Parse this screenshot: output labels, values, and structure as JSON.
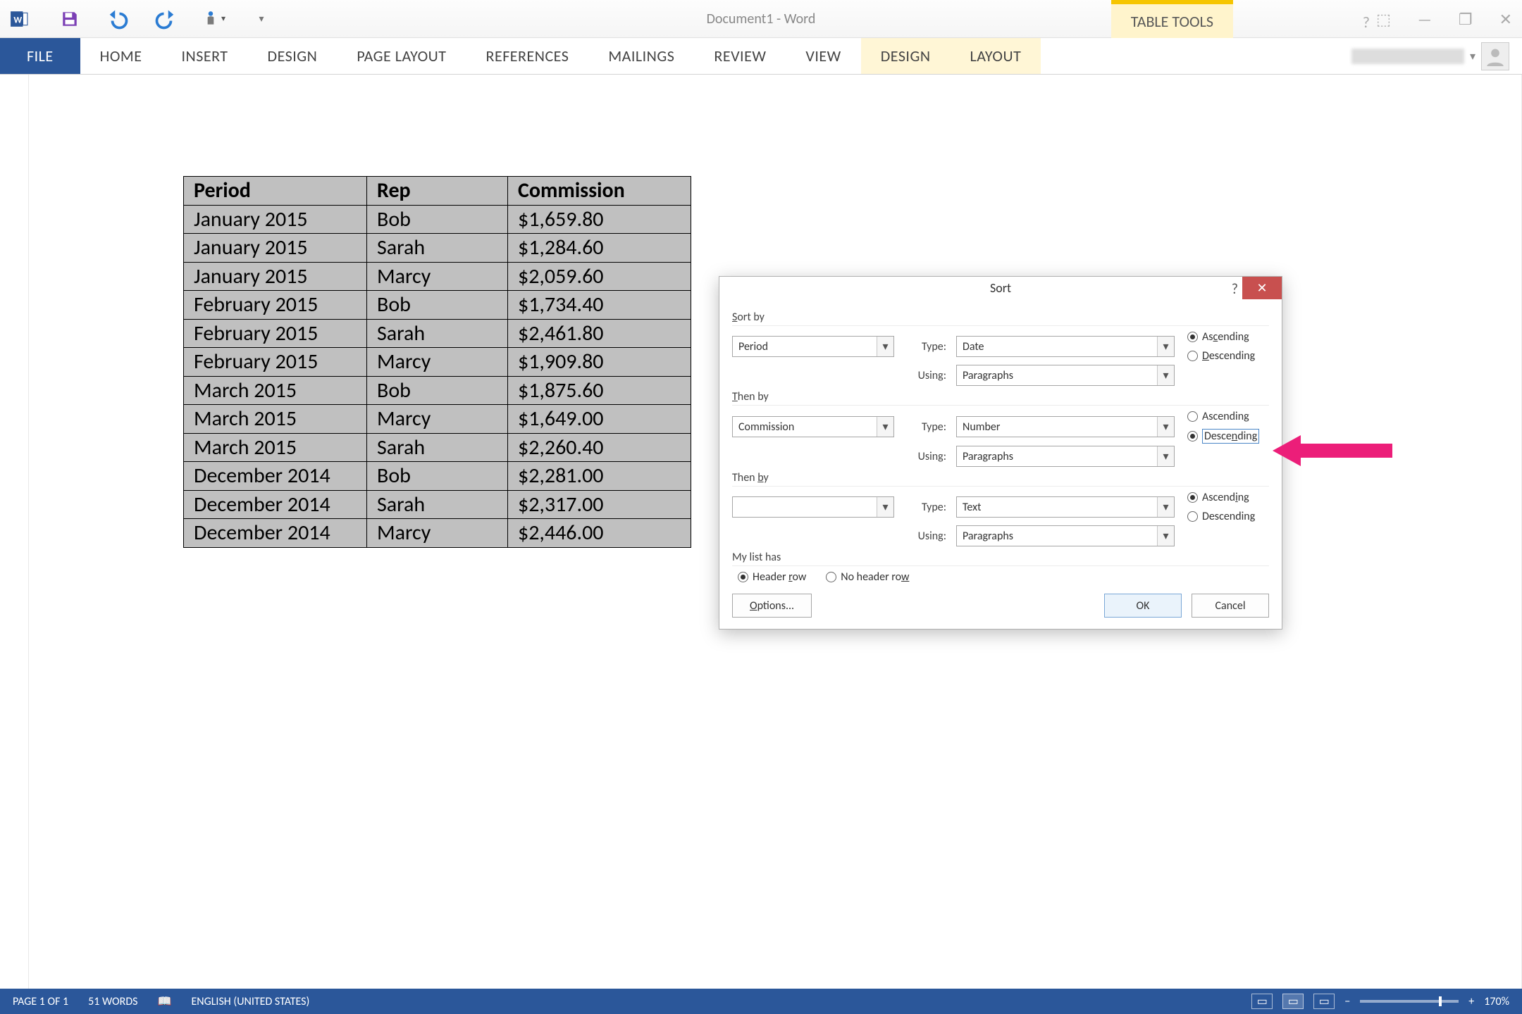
{
  "window": {
    "title": "Document1 - Word",
    "table_tools_label": "TABLE TOOLS"
  },
  "ribbon": {
    "file": "FILE",
    "tabs": [
      "HOME",
      "INSERT",
      "DESIGN",
      "PAGE LAYOUT",
      "REFERENCES",
      "MAILINGS",
      "REVIEW",
      "VIEW"
    ],
    "context_tabs": [
      "DESIGN",
      "LAYOUT"
    ]
  },
  "table": {
    "headers": [
      "Period",
      "Rep",
      "Commission"
    ],
    "rows": [
      [
        "January 2015",
        "Bob",
        "$1,659.80"
      ],
      [
        "January 2015",
        "Sarah",
        "$1,284.60"
      ],
      [
        "January 2015",
        "Marcy",
        "$2,059.60"
      ],
      [
        "February 2015",
        "Bob",
        "$1,734.40"
      ],
      [
        "February 2015",
        "Sarah",
        "$2,461.80"
      ],
      [
        "February 2015",
        "Marcy",
        "$1,909.80"
      ],
      [
        "March 2015",
        "Bob",
        "$1,875.60"
      ],
      [
        "March 2015",
        "Marcy",
        "$1,649.00"
      ],
      [
        "March 2015",
        "Sarah",
        "$2,260.40"
      ],
      [
        "December 2014",
        "Bob",
        "$2,281.00"
      ],
      [
        "December 2014",
        "Sarah",
        "$2,317.00"
      ],
      [
        "December 2014",
        "Marcy",
        "$2,446.00"
      ]
    ]
  },
  "dialog": {
    "title": "Sort",
    "sort_by_label": "Sort by",
    "then_by_label": "Then by",
    "then_by2_label": "Then by",
    "type_label": "Type:",
    "using_label": "Using:",
    "ascending": "Ascending",
    "descending": "Descending",
    "my_list_has": "My list has",
    "header_row": "Header row",
    "no_header_row": "No header row",
    "options": "Options...",
    "ok": "OK",
    "cancel": "Cancel",
    "sort1": {
      "column": "Period",
      "type": "Date",
      "using": "Paragraphs",
      "dir": "Ascending"
    },
    "sort2": {
      "column": "Commission",
      "type": "Number",
      "using": "Paragraphs",
      "dir": "Descending"
    },
    "sort3": {
      "column": "",
      "type": "Text",
      "using": "Paragraphs",
      "dir": "Ascending"
    }
  },
  "status": {
    "page": "PAGE 1 OF 1",
    "words": "51 WORDS",
    "language": "ENGLISH (UNITED STATES)",
    "zoom": "170%"
  }
}
